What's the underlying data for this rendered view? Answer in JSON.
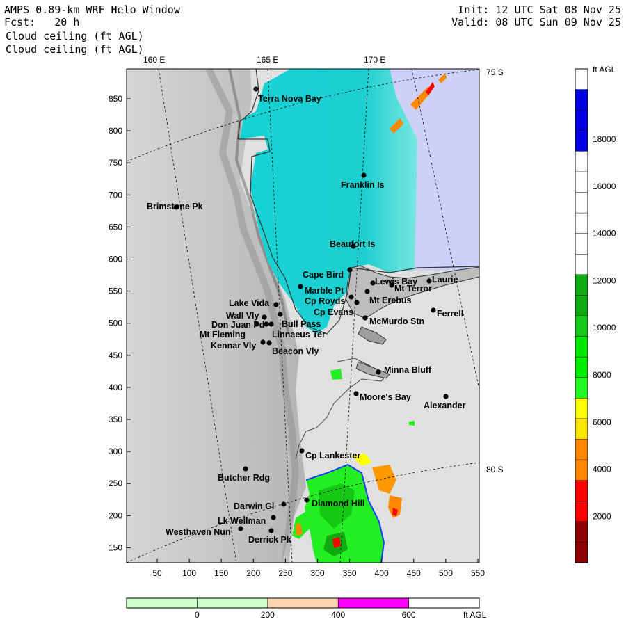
{
  "header": {
    "title": "AMPS 0.89-km WRF Helo Window",
    "fcst": "Fcst:   20 h",
    "field1": "Cloud ceiling (ft AGL)",
    "field2": "Cloud ceiling (ft AGL)",
    "init": "Init: 12 UTC Sat 08 Nov 25",
    "valid": "Valid: 08 UTC Sun 09 Nov 25"
  },
  "map": {
    "lon_labels": [
      "160 E",
      "165 E",
      "170 E"
    ],
    "lat_labels": [
      "75 S",
      "80 S"
    ],
    "x_ticks": [
      "50",
      "100",
      "150",
      "200",
      "250",
      "300",
      "350",
      "400",
      "450",
      "500",
      "550"
    ],
    "y_ticks": [
      "850",
      "800",
      "750",
      "700",
      "650",
      "600",
      "550",
      "500",
      "450",
      "400",
      "350",
      "300",
      "250",
      "200",
      "150"
    ],
    "places": [
      {
        "name": "Terra Nova Bay"
      },
      {
        "name": "Franklin Is"
      },
      {
        "name": "Brimstone Pk"
      },
      {
        "name": "Beaufort Is"
      },
      {
        "name": "Cape Bird"
      },
      {
        "name": "Lewis Bay"
      },
      {
        "name": "Laurie"
      },
      {
        "name": "Mt Terror"
      },
      {
        "name": "Marble Pt"
      },
      {
        "name": "Cp Royds"
      },
      {
        "name": "Mt Erebus"
      },
      {
        "name": "Lake Vida"
      },
      {
        "name": "Cp Evans"
      },
      {
        "name": "Ferrell"
      },
      {
        "name": "Wall Vly"
      },
      {
        "name": "Bull Pass"
      },
      {
        "name": "McMurdo Stn"
      },
      {
        "name": "Don Juan Pd"
      },
      {
        "name": "Mt Fleming"
      },
      {
        "name": "Linnaeus Ter"
      },
      {
        "name": "Kennar Vly"
      },
      {
        "name": "Beacon Vly"
      },
      {
        "name": "Minna Bluff"
      },
      {
        "name": "Moore's Bay"
      },
      {
        "name": "Alexander"
      },
      {
        "name": "Cp Lankester"
      },
      {
        "name": "Butcher Rdg"
      },
      {
        "name": "Darwin Gl"
      },
      {
        "name": "Diamond Hill"
      },
      {
        "name": "Lk Wellman"
      },
      {
        "name": "Westhaven Nun"
      },
      {
        "name": "Derrick Pk"
      }
    ]
  },
  "colorbar": {
    "unit": "ft AGL",
    "labels": [
      "18000",
      "16000",
      "14000",
      "12000",
      "10000",
      "8000",
      "6000",
      "4000",
      "2000"
    ],
    "colors": [
      "#ffffff",
      "#0000e0",
      "#0000e0",
      "#0000e0",
      "#ffffff",
      "#ffffff",
      "#ffffff",
      "#ffffff",
      "#ffffff",
      "#ffffff",
      "#12aa12",
      "#12aa12",
      "#18c818",
      "#00e600",
      "#00ee00",
      "#22f822",
      "#ffff00",
      "#ffe600",
      "#ff8800",
      "#ff8800",
      "#ff0000",
      "#ff0000",
      "#8b0000",
      "#8b0000"
    ]
  },
  "bottom_bar": {
    "labels": [
      "0",
      "200",
      "400",
      "600"
    ],
    "unit": "ft AGL",
    "colors": [
      "#ccffcc",
      "#ccffcc",
      "#ffd5b0",
      "#ff00ff",
      "#ffffff"
    ]
  }
}
